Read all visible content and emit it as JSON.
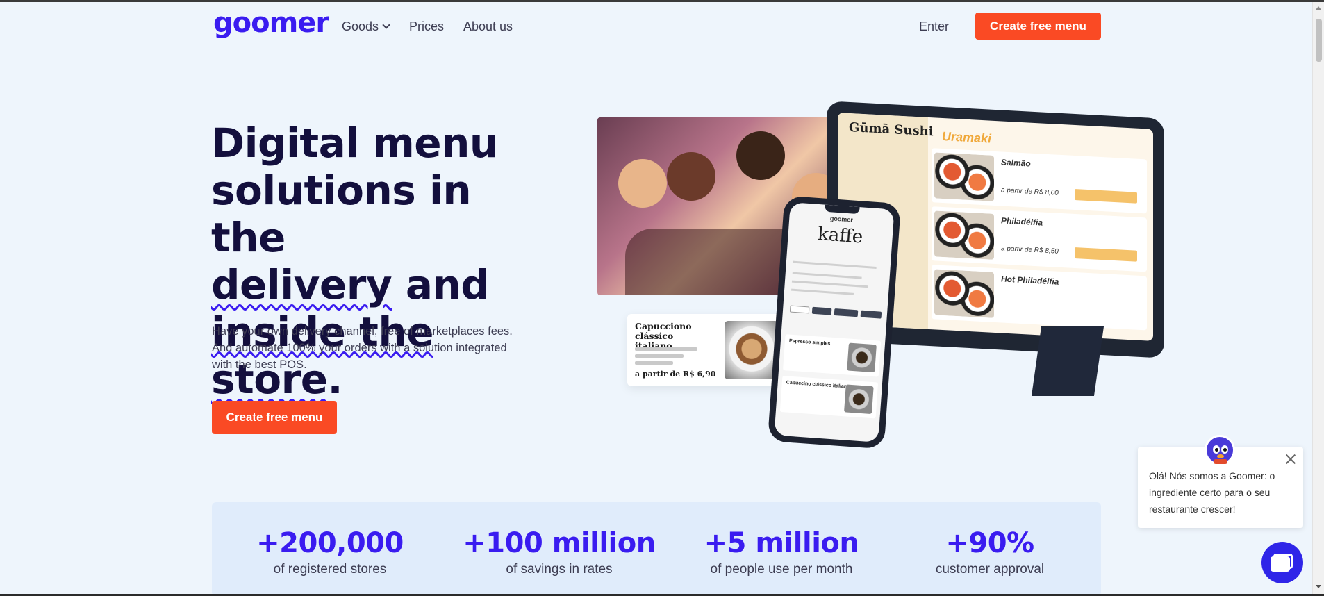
{
  "nav": {
    "logo": "goomer",
    "links": [
      {
        "label": "Goods"
      },
      {
        "label": "Prices"
      },
      {
        "label": "About us"
      }
    ],
    "enter": "Enter",
    "cta": "Create free menu"
  },
  "hero": {
    "title_line1": "Digital menu",
    "title_line2": "solutions in the",
    "title_delivery": "delivery",
    "title_and": " and",
    "title_inside": "inside the store",
    "title_period": ".",
    "subtitle": "Have your own delivery channel, free of marketplaces fees. And automate 100% your orders with a solution integrated with the best POS.",
    "cta": "Create free menu"
  },
  "mockups": {
    "tablet_brand": "Gūmā Sushi",
    "tablet_heading": "Uramaki",
    "tablet_items": [
      {
        "name": "Salmão",
        "price": "a partir de R$ 8,00"
      },
      {
        "name": "Philadélfia",
        "price": "a partir de R$ 8,50"
      },
      {
        "name": "Hot Philadélfia",
        "price": ""
      }
    ],
    "phone_brand": "goomer",
    "phone_store": "kaffe",
    "phone_items": [
      {
        "name": "Espresso simples"
      },
      {
        "name": "Capuccino clássico italiano"
      }
    ],
    "card_title": "Capucciono clássico italiano",
    "card_price": "a partir de R$ 6,90"
  },
  "stats": [
    {
      "value": "+200,000",
      "label": "of registered stores"
    },
    {
      "value": "+100 million",
      "label": "of savings in rates"
    },
    {
      "value": "+5 million",
      "label": "of people use per month"
    },
    {
      "value": "+90%",
      "label": "customer approval"
    }
  ],
  "chat": {
    "message": "Olá! Nós somos a Goomer: o ingrediente certo para o seu restaurante crescer!"
  },
  "colors": {
    "brand": "#3a1cf0",
    "cta": "#fa4a24",
    "background": "#eef5fc"
  }
}
